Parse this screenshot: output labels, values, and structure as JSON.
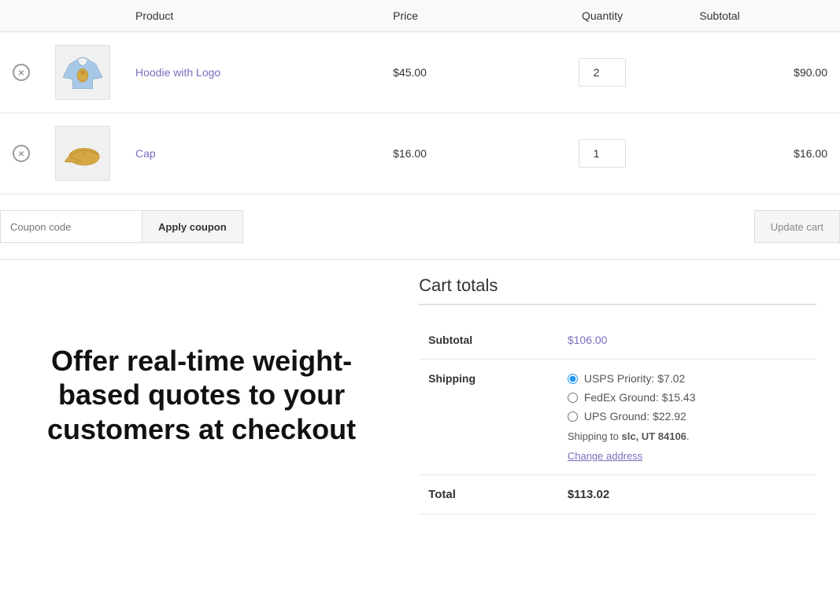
{
  "table": {
    "headers": {
      "product": "Product",
      "price": "Price",
      "quantity": "Quantity",
      "subtotal": "Subtotal"
    },
    "rows": [
      {
        "id": "row-1",
        "product_name": "Hoodie with Logo",
        "price": "$45.00",
        "quantity": 2,
        "subtotal": "$90.00",
        "image_type": "hoodie"
      },
      {
        "id": "row-2",
        "product_name": "Cap",
        "price": "$16.00",
        "quantity": 1,
        "subtotal": "$16.00",
        "image_type": "cap"
      }
    ]
  },
  "coupon": {
    "input_placeholder": "Coupon code",
    "apply_label": "Apply coupon",
    "update_label": "Update cart"
  },
  "cart_totals": {
    "title": "Cart totals",
    "subtotal_label": "Subtotal",
    "subtotal_value": "$106.00",
    "shipping_label": "Shipping",
    "shipping_options": [
      {
        "label": "USPS Priority: $7.02",
        "selected": true
      },
      {
        "label": "FedEx Ground: $15.43",
        "selected": false
      },
      {
        "label": "UPS Ground: $22.92",
        "selected": false
      }
    ],
    "shipping_note": "Shipping to ",
    "shipping_location": "slc, UT 84106",
    "change_address": "Change address",
    "total_label": "Total",
    "total_value": "$113.02"
  },
  "promo": {
    "text": "Offer real-time weight-based quotes to your customers at checkout"
  }
}
